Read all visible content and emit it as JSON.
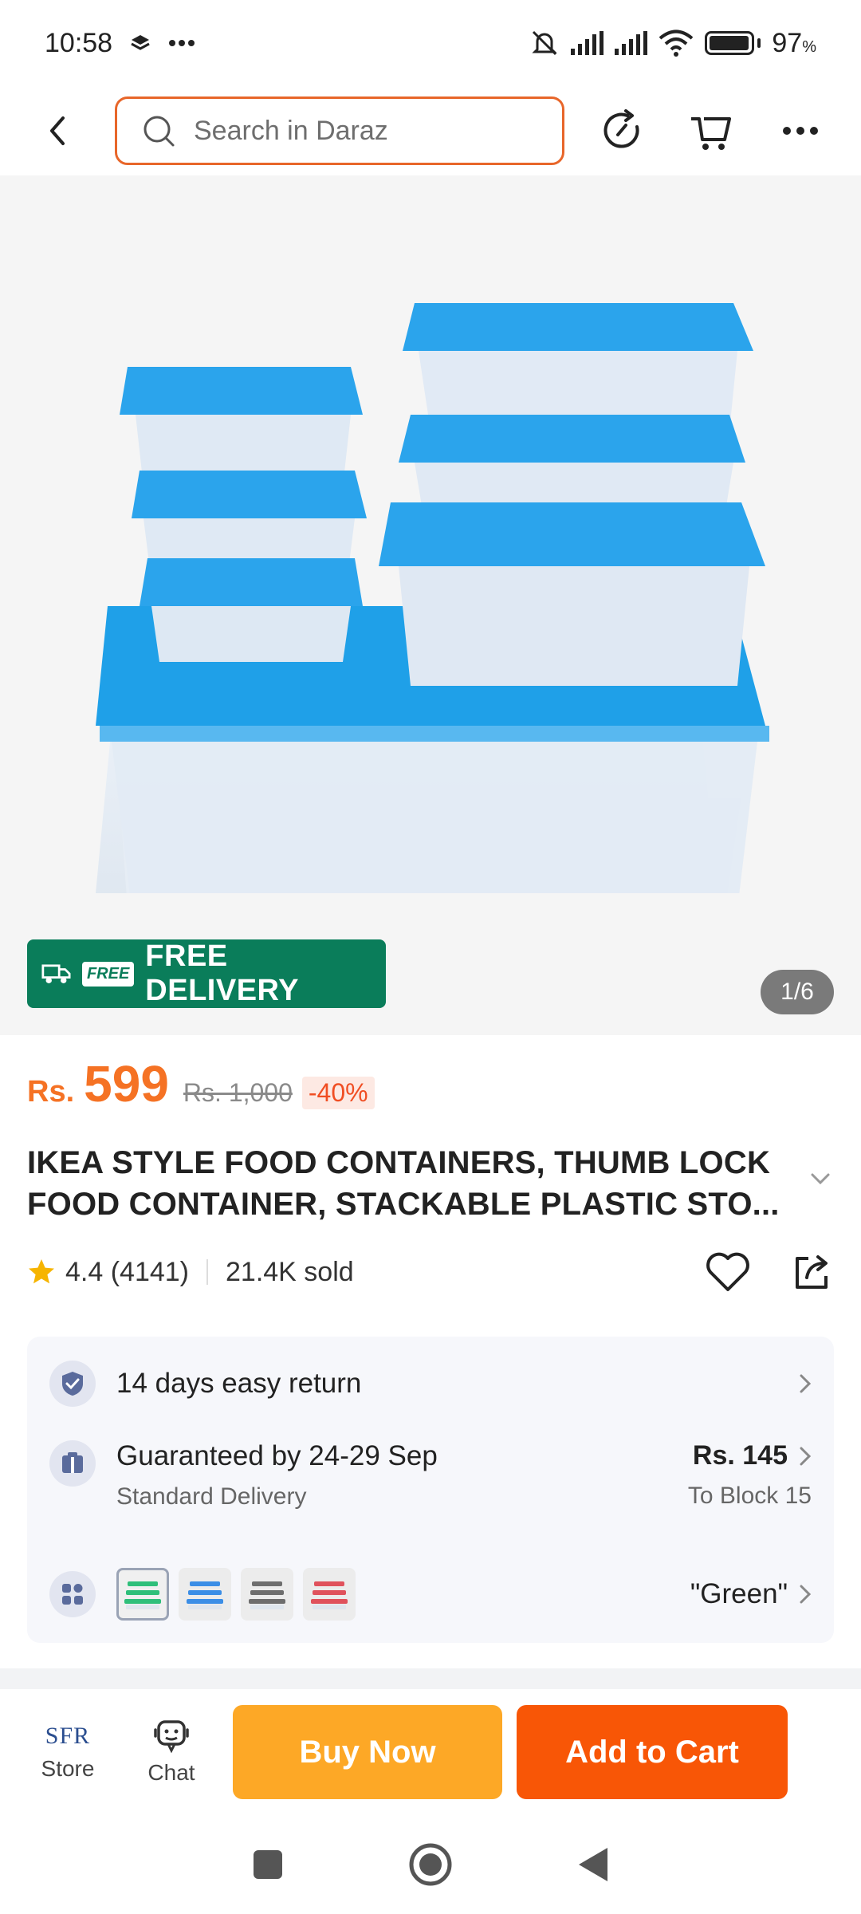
{
  "status_bar": {
    "time": "10:58",
    "battery": "97",
    "battery_unit": "%",
    "battery_level": 0.97
  },
  "search": {
    "placeholder": "Search in Daraz"
  },
  "gallery": {
    "badge_tag": "FREE",
    "badge_text": "FREE DELIVERY",
    "pager": "1/6"
  },
  "price": {
    "currency": "Rs.",
    "value": "599",
    "original": "Rs. 1,000",
    "discount": "-40%"
  },
  "product": {
    "title": "IKEA STYLE FOOD CONTAINERS, THUMB LOCK FOOD CONTAINER, STACKABLE PLASTIC STO..."
  },
  "rating": {
    "score": "4.4",
    "count": "(4141)",
    "sold": "21.4K sold"
  },
  "info": {
    "return": "14 days easy return",
    "delivery": "Guaranteed by 24-29 Sep",
    "delivery_type": "Standard Delivery",
    "delivery_price": "Rs. 145",
    "delivery_to": "To Block 15",
    "variant_selected": "\"Green\""
  },
  "variants": [
    {
      "color": "#2fbf7a"
    },
    {
      "color": "#3b8ee6"
    },
    {
      "color": "#6e6e6e"
    },
    {
      "color": "#e0525c"
    }
  ],
  "bottom": {
    "store_label": "Store",
    "store_logo": "SFR",
    "chat_label": "Chat",
    "buy_now": "Buy Now",
    "add_to_cart": "Add to Cart"
  },
  "colors": {
    "accent": "#f57224",
    "buy": "#fda826",
    "cart": "#f85606",
    "free_badge": "#0a7d5a"
  }
}
